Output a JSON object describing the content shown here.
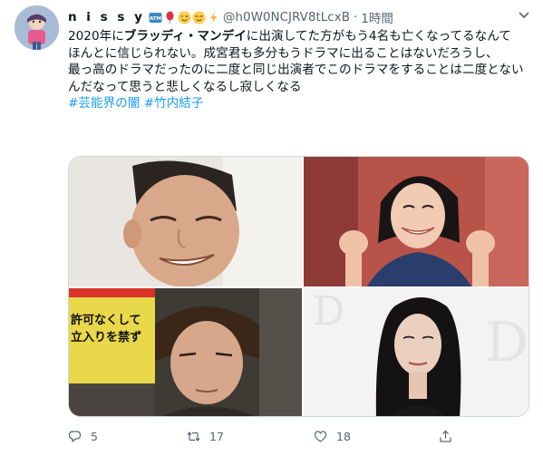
{
  "user": {
    "display_name": "n i s s y",
    "handle": "@h0W0NCJRV8tLcxB",
    "separator": "·",
    "time": "1時間",
    "emojis": [
      "atm-icon",
      "balloon-icon",
      "winking-face-icon",
      "smiling-face-icon",
      "lightning-icon"
    ]
  },
  "tweet": {
    "line1_prefix": "2020年に",
    "line1_bold": "ブラッディ・マンデイ",
    "line1_suffix": "に出演してた方がもう4名も亡くなってるなんて",
    "line2": "ほんとに信じられない。成宮君も多分もうドラマに出ることはないだろうし、",
    "line3": "最っ高のドラマだったのに二度と同じ出演者でこのドラマをすることは二度とないんだなって思うと悲しくなるし寂しくなる",
    "hashtags": [
      "#芸能界の闇",
      "#竹内結子"
    ]
  },
  "media": {
    "photo3_sign_line1": "許可なくして",
    "photo3_sign_line2": "立入りを禁ず"
  },
  "actions": {
    "reply_count": "5",
    "retweet_count": "17",
    "like_count": "18"
  },
  "colors": {
    "link": "#1d9bf0",
    "secondary_text": "#536471",
    "border": "#cfd9de"
  }
}
